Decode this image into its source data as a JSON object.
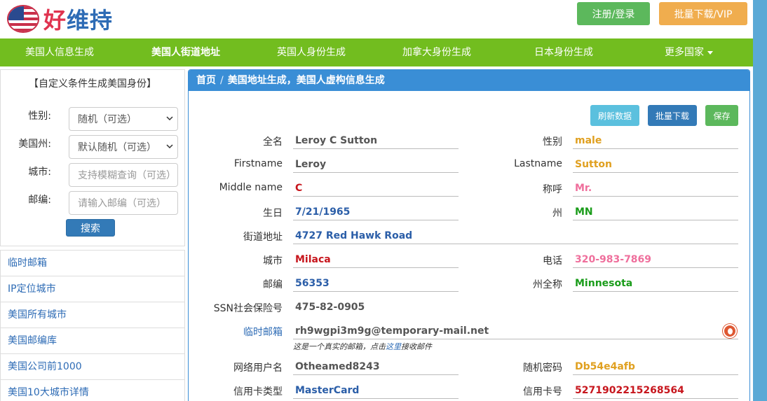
{
  "header": {
    "logo_hao": "好",
    "logo_rest": "维持",
    "login_label": "注册/登录",
    "vip_label": "批量下载/VIP"
  },
  "nav": {
    "items": [
      "美国人信息生成",
      "美国人街道地址",
      "英国人身份生成",
      "加拿大身份生成",
      "日本身份生成",
      "更多国家"
    ],
    "active": "美国人街道地址"
  },
  "sidebar": {
    "title": "【自定义条件生成美国身份】",
    "gender_label": "性别:",
    "gender_value": "随机（可选）",
    "state_label": "美国州:",
    "state_value": "默认随机（可选）",
    "city_label": "城市:",
    "city_placeholder": "支持模糊查询（可选）",
    "zip_label": "邮编:",
    "zip_placeholder": "请输入邮编（可选）",
    "search_label": "搜索",
    "links": [
      "临时邮箱",
      "IP定位城市",
      "美国所有城市",
      "美国邮编库",
      "美国公司前1000",
      "美国10大城市详情"
    ]
  },
  "breadcrumb": {
    "home": "首页",
    "separator": "/",
    "current": "美国地址生成，美国人虚构信息生成"
  },
  "actions": {
    "refresh": "刷新数据",
    "batch": "批量下载",
    "save": "保存"
  },
  "fields": {
    "fullname_label": "全名",
    "fullname": "Leroy C Sutton",
    "gender_label": "性别",
    "gender": "male",
    "firstname_label": "Firstname",
    "firstname": "Leroy",
    "lastname_label": "Lastname",
    "lastname": "Sutton",
    "middle_label": "Middle name",
    "middle": "C",
    "title_label": "称呼",
    "title": "Mr.",
    "birthday_label": "生日",
    "birthday": "7/21/1965",
    "state_label": "州",
    "state": "MN",
    "street_label": "街道地址",
    "street": "4727 Red Hawk Road",
    "city_label": "城市",
    "city": "Milaca",
    "phone_label": "电话",
    "phone": "320-983-7869",
    "zip_label": "邮编",
    "zip": "56353",
    "state_full_label": "州全称",
    "state_full": "Minnesota",
    "ssn_label": "SSN社会保险号",
    "ssn": "475-82-0905",
    "email_label": "临时邮箱",
    "email": "rh9wgpi3m9g@temporary-mail.net",
    "email_note_pre": "这是一个真实的邮箱，点击",
    "email_note_link": "这里",
    "email_note_post": "接收邮件",
    "username_label": "网络用户名",
    "username": "Otheamed8243",
    "password_label": "随机密码",
    "password": "Db54e4afb",
    "cardtype_label": "信用卡类型",
    "cardtype": "MasterCard",
    "cardnum_label": "信用卡号",
    "cardnum": "5271902215268564"
  },
  "colors": {
    "nav_green": "#72bd1f",
    "panel_blue": "#3a8ed6",
    "value_blue": "#2b5ea8",
    "value_red": "#c7161d",
    "value_orange": "#e0a020",
    "value_pink": "#ef6f9c",
    "value_green": "#1a9c1a"
  }
}
